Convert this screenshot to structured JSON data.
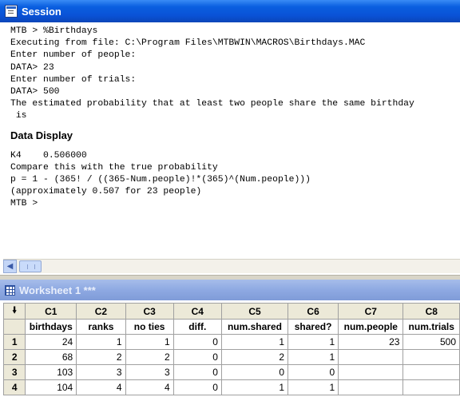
{
  "session": {
    "title": "Session",
    "lines_top": [
      "MTB > %Birthdays",
      "Executing from file: C:\\Program Files\\MTBWIN\\MACROS\\Birthdays.MAC",
      "Enter number of people:",
      "DATA> 23",
      "Enter number of trials:",
      "DATA> 500",
      "The estimated probability that at least two people share the same birthday",
      " is"
    ],
    "section_heading": "Data Display",
    "lines_bottom": [
      "K4    0.506000",
      "Compare this with the true probability",
      "p = 1 - (365! / ((365-Num.people)!*(365)^(Num.people)))",
      "(approximately 0.507 for 23 people)",
      "MTB >"
    ]
  },
  "worksheet": {
    "title": "Worksheet 1 ***",
    "corner_icon": "down-arrow-icon",
    "columns": [
      "C1",
      "C2",
      "C3",
      "C4",
      "C5",
      "C6",
      "C7",
      "C8"
    ],
    "column_names": [
      "birthdays",
      "ranks",
      "no ties",
      "diff.",
      "num.shared",
      "shared?",
      "num.people",
      "num.trials"
    ],
    "rows": [
      {
        "label": "1",
        "cells": [
          "24",
          "1",
          "1",
          "0",
          "1",
          "1",
          "23",
          "500"
        ]
      },
      {
        "label": "2",
        "cells": [
          "68",
          "2",
          "2",
          "0",
          "2",
          "1",
          "",
          ""
        ]
      },
      {
        "label": "3",
        "cells": [
          "103",
          "3",
          "3",
          "0",
          "0",
          "0",
          "",
          ""
        ]
      },
      {
        "label": "4",
        "cells": [
          "104",
          "4",
          "4",
          "0",
          "1",
          "1",
          "",
          ""
        ]
      }
    ]
  }
}
